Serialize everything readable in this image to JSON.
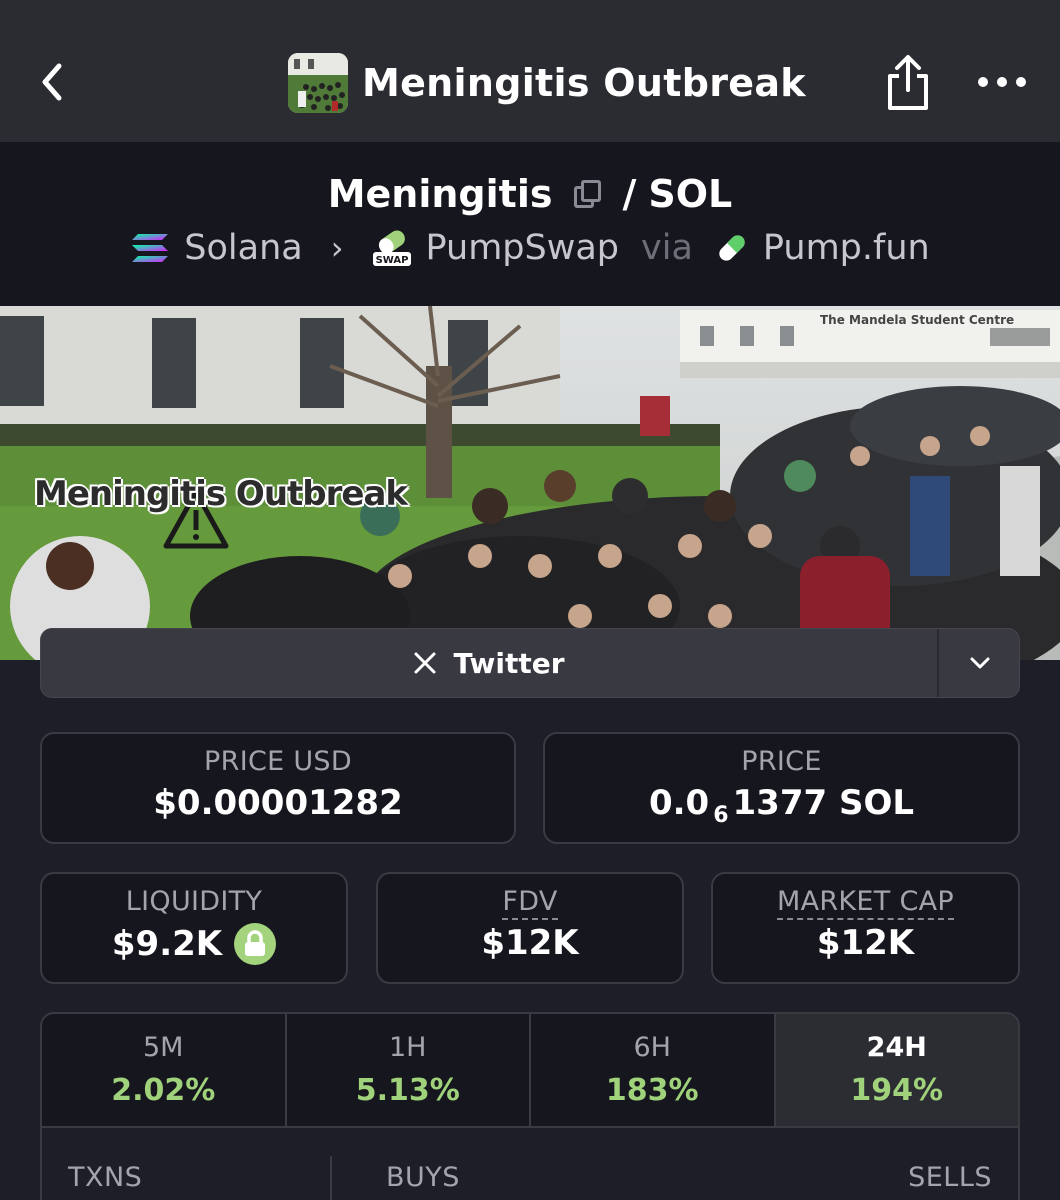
{
  "nav": {
    "title": "Meningitis Outbreak"
  },
  "pair": {
    "base": "Meningitis",
    "separator": "/",
    "quote": "SOL"
  },
  "route": {
    "chain": "Solana",
    "dex": "PumpSwap",
    "dex_badge": "SWAP",
    "via_label": "via",
    "launchpad": "Pump.fun"
  },
  "banner": {
    "caption": "Meningitis Outbreak",
    "sign_text": "The Mandela Student Centre"
  },
  "twitter": {
    "label": "Twitter"
  },
  "stats": {
    "price_usd": {
      "label": "PRICE USD",
      "value": "$0.00001282"
    },
    "price": {
      "label": "PRICE",
      "prefix": "0.0",
      "zeros": "6",
      "suffix": "1377 SOL"
    },
    "liquidity": {
      "label": "LIQUIDITY",
      "value": "$9.2K"
    },
    "fdv": {
      "label": "FDV",
      "value": "$12K"
    },
    "market_cap": {
      "label": "MARKET CAP",
      "value": "$12K"
    }
  },
  "timeframes": [
    {
      "label": "5M",
      "change": "2.02%"
    },
    {
      "label": "1H",
      "change": "5.13%"
    },
    {
      "label": "6H",
      "change": "183%"
    },
    {
      "label": "24H",
      "change": "194%",
      "active": true
    }
  ],
  "txns": {
    "txns_label": "TXNS",
    "buys_label": "BUYS",
    "sells_label": "SELLS"
  },
  "colors": {
    "background": "#1e1e28",
    "topbar": "#2b2c31",
    "panel": "#16161e",
    "positive": "#9fd27a",
    "border": "#393a42"
  },
  "icons": [
    "back-chevron-icon",
    "share-icon",
    "more-icon",
    "copy-icon",
    "solana-icon",
    "pumpswap-icon",
    "pill-icon",
    "x-icon",
    "chevron-down-icon",
    "lock-icon",
    "warning-icon"
  ]
}
